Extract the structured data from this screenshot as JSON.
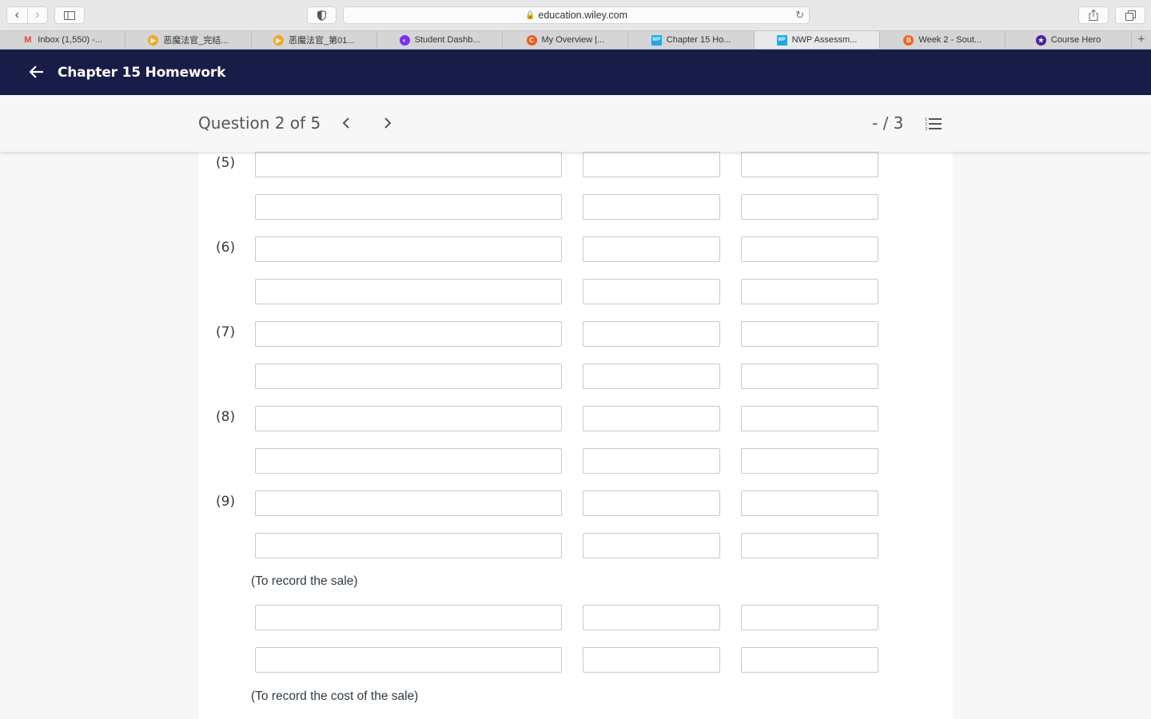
{
  "browser": {
    "url": "education.wiley.com",
    "tabs": [
      {
        "label": "Inbox (1,550) -...",
        "icon": "gmail-icon",
        "color": "#ea4335"
      },
      {
        "label": "恶魔法官_完结...",
        "icon": "play-icon",
        "color": "#f5a623"
      },
      {
        "label": "恶魔法官_第01...",
        "icon": "play-icon",
        "color": "#f5a623"
      },
      {
        "label": "Student Dashb...",
        "icon": "dashboard-icon",
        "color": "#7b2ff7"
      },
      {
        "label": "My Overview |...",
        "icon": "chegg-icon",
        "color": "#eb5b1e"
      },
      {
        "label": "Chapter 15 Ho...",
        "icon": "wileyplus-icon",
        "color": "#1fa8f0"
      },
      {
        "label": "NWP Assessm...",
        "icon": "wileyplus-icon",
        "color": "#1fa8f0",
        "active": true
      },
      {
        "label": "Week 2 - Sout...",
        "icon": "brightspace-icon",
        "color": "#f26522"
      },
      {
        "label": "Course Hero",
        "icon": "coursehero-icon",
        "color": "#4b1fa6"
      }
    ]
  },
  "header": {
    "title": "Chapter 15 Homework"
  },
  "question_bar": {
    "label": "Question 2 of 5",
    "score": "- / 3"
  },
  "entries": [
    {
      "number": "(5)",
      "rows": [
        {
          "account": "",
          "debit": "",
          "credit": ""
        },
        {
          "account": "",
          "debit": "",
          "credit": ""
        }
      ]
    },
    {
      "number": "(6)",
      "rows": [
        {
          "account": "",
          "debit": "",
          "credit": ""
        },
        {
          "account": "",
          "debit": "",
          "credit": ""
        }
      ]
    },
    {
      "number": "(7)",
      "rows": [
        {
          "account": "",
          "debit": "",
          "credit": ""
        },
        {
          "account": "",
          "debit": "",
          "credit": ""
        }
      ]
    },
    {
      "number": "(8)",
      "rows": [
        {
          "account": "",
          "debit": "",
          "credit": ""
        },
        {
          "account": "",
          "debit": "",
          "credit": ""
        }
      ]
    },
    {
      "number": "(9)",
      "rows": [
        {
          "account": "",
          "debit": "",
          "credit": ""
        },
        {
          "account": "",
          "debit": "",
          "credit": ""
        }
      ]
    }
  ],
  "notes": {
    "sale": "(To record the sale)",
    "cost_of_sale": "(To record the cost of the sale)"
  },
  "colors": {
    "header_bg": "#181c48",
    "panel_bg": "#ffffff",
    "page_bg": "#f7f7f7"
  }
}
